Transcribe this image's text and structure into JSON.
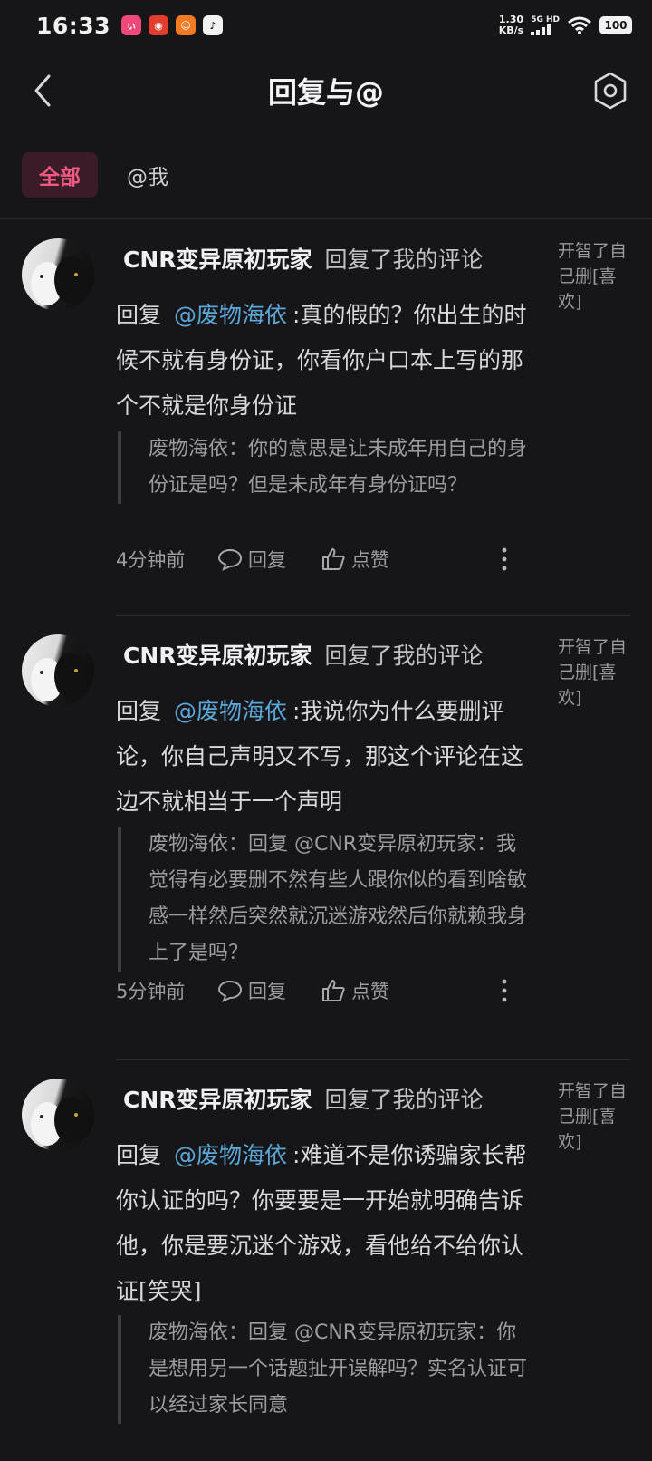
{
  "status_bar": {
    "time": "16:33",
    "speed_value": "1.30",
    "speed_unit": "KB/s",
    "network": "5G HD",
    "battery": "100"
  },
  "header": {
    "title": "回复与@"
  },
  "tabs": [
    {
      "label": "全部",
      "active": true
    },
    {
      "label": "@我",
      "active": false
    }
  ],
  "items": [
    {
      "username": "CNR变异原初玩家",
      "action": "回复了我的评论",
      "reply_prefix": "回复",
      "mention": "@废物海依",
      "comment": ":真的假的？你出生的时候不就有身份证，你看你户口本上写的那个不就是你身份证",
      "quote": "废物海依：你的意思是让未成年用自己的身份证是吗？但是未成年有身份证吗？",
      "time": "4分钟前",
      "reply_label": "回复",
      "like_label": "点赞",
      "original_snippet": "开智了自己删[喜欢]"
    },
    {
      "username": "CNR变异原初玩家",
      "action": "回复了我的评论",
      "reply_prefix": "回复",
      "mention": "@废物海依",
      "comment": ":我说你为什么要删评论，你自己声明又不写，那这个评论在这边不就相当于一个声明",
      "quote": "废物海依：回复 @CNR变异原初玩家：我觉得有必要删不然有些人跟你似的看到啥敏感一样然后突然就沉迷游戏然后你就赖我身上了是吗？",
      "time": "5分钟前",
      "reply_label": "回复",
      "like_label": "点赞",
      "original_snippet": "开智了自己删[喜欢]"
    },
    {
      "username": "CNR变异原初玩家",
      "action": "回复了我的评论",
      "reply_prefix": "回复",
      "mention": "@废物海依",
      "comment": ":难道不是你诱骗家长帮你认证的吗？你要要是一开始就明确告诉他，你是要沉迷个游戏，看他给不给你认证[笑哭]",
      "quote": "废物海依：回复 @CNR变异原初玩家：你是想用另一个话题扯开误解吗？实名认证可以经过家长同意",
      "original_snippet": "开智了自己删[喜欢]"
    }
  ],
  "colors": {
    "background": "#161618",
    "accent_pink": "#ee5a82",
    "mention_blue": "#5aa7d8"
  }
}
